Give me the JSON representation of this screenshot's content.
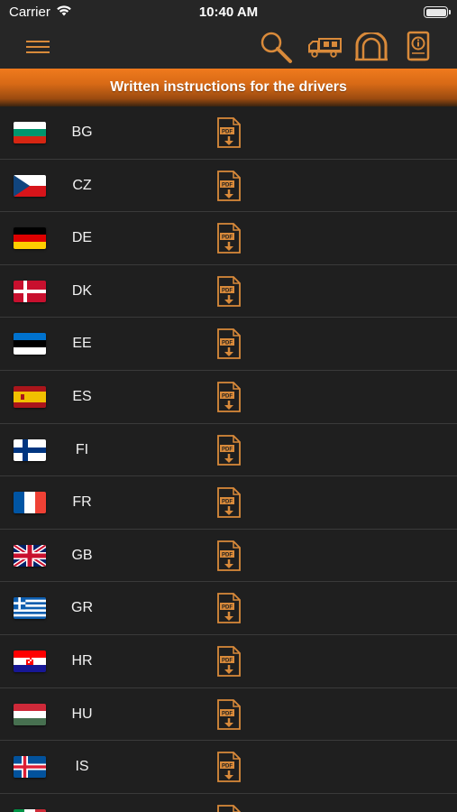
{
  "status_bar": {
    "carrier": "Carrier",
    "time": "10:40 AM"
  },
  "nav": {
    "icons": [
      "menu-icon",
      "search-icon",
      "truck-icon",
      "tunnel-icon",
      "info-book-icon"
    ]
  },
  "banner": {
    "title": "Written instructions for the drivers"
  },
  "colors": {
    "accent": "#d98a3a",
    "banner_orange": "#f07a1d",
    "background": "#1f1f1f"
  },
  "countries": [
    {
      "code": "BG",
      "flag": "bg"
    },
    {
      "code": "CZ",
      "flag": "cz"
    },
    {
      "code": "DE",
      "flag": "de"
    },
    {
      "code": "DK",
      "flag": "dk"
    },
    {
      "code": "EE",
      "flag": "ee"
    },
    {
      "code": "ES",
      "flag": "es"
    },
    {
      "code": "FI",
      "flag": "fi"
    },
    {
      "code": "FR",
      "flag": "fr"
    },
    {
      "code": "GB",
      "flag": "gb"
    },
    {
      "code": "GR",
      "flag": "gr"
    },
    {
      "code": "HR",
      "flag": "hr"
    },
    {
      "code": "HU",
      "flag": "hu"
    },
    {
      "code": "IS",
      "flag": "is"
    },
    {
      "code": "",
      "flag": "it"
    }
  ]
}
